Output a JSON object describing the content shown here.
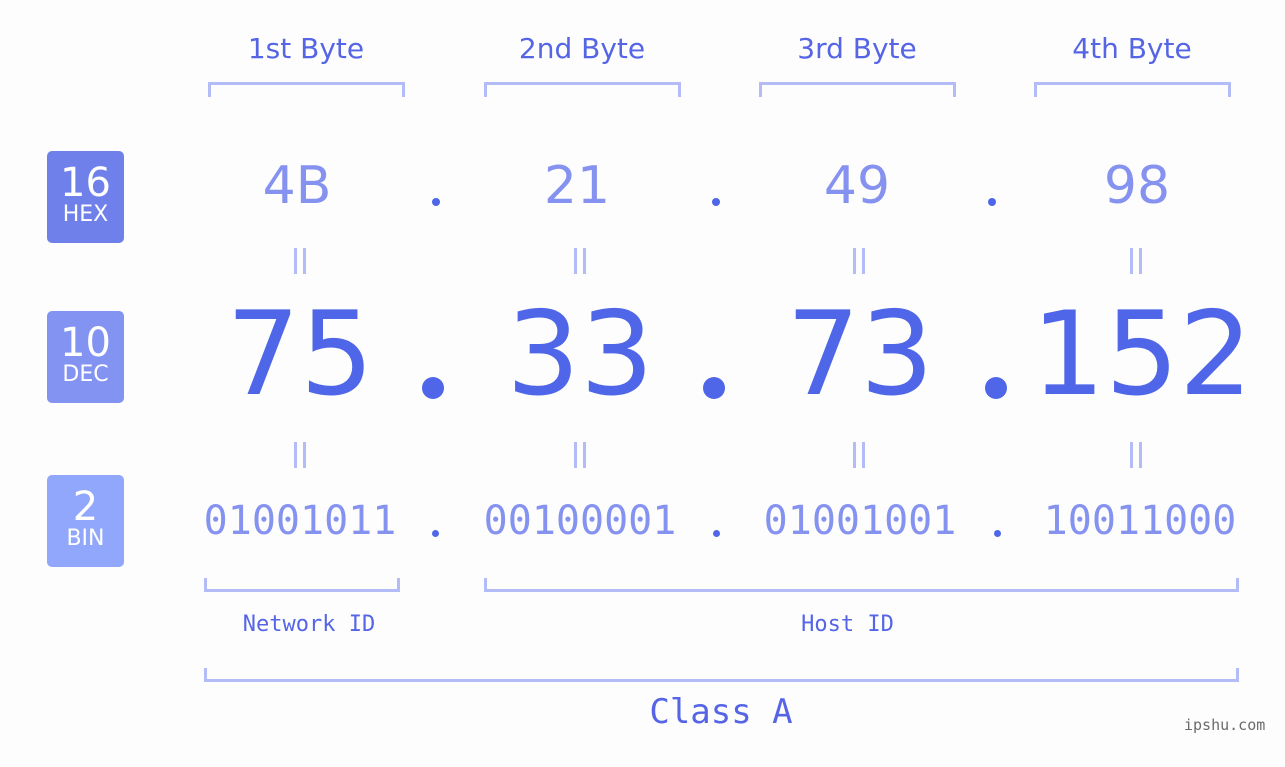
{
  "header": {
    "bytes": [
      "1st Byte",
      "2nd Byte",
      "3rd Byte",
      "4th Byte"
    ]
  },
  "badges": {
    "hex": {
      "base": "16",
      "label": "HEX",
      "color": "#7080eb"
    },
    "dec": {
      "base": "10",
      "label": "DEC",
      "color": "#8393f1"
    },
    "bin": {
      "base": "2",
      "label": "BIN",
      "color": "#91a7fb"
    }
  },
  "ip": {
    "hex": [
      "4B",
      "21",
      "49",
      "98"
    ],
    "dec": [
      "75",
      "33",
      "73",
      "152"
    ],
    "bin": [
      "01001011",
      "00100001",
      "01001001",
      "10011000"
    ]
  },
  "sections": {
    "network_id": "Network ID",
    "host_id": "Host ID",
    "class": "Class A"
  },
  "colors": {
    "accent": "#5066e8",
    "light_accent": "#8592ef",
    "bracket": "#b3bcf6"
  },
  "watermark": "ipshu.com"
}
